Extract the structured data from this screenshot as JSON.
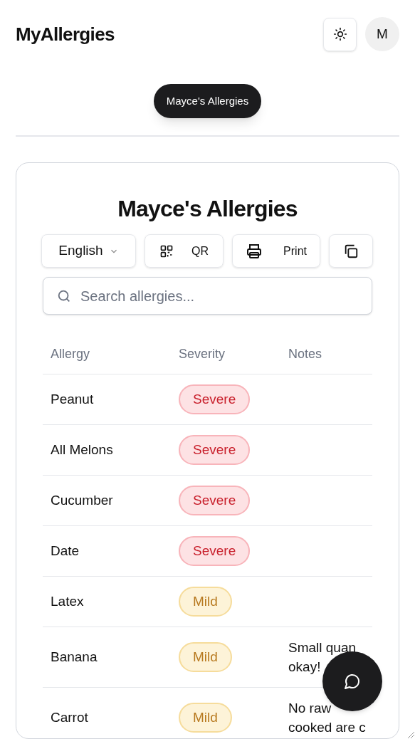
{
  "app_title": "MyAllergies",
  "avatar": "M",
  "profile_pill": "Mayce's Allergies",
  "card": {
    "title": "Mayce's Allergies",
    "language": "English",
    "qr_label": "QR",
    "print_label": "Print",
    "search": {
      "placeholder": "Search allergies..."
    },
    "table": {
      "columns": [
        "Allergy",
        "Severity",
        "Notes"
      ],
      "rows": [
        {
          "allergy": "Peanut",
          "severity": "Severe",
          "kind": "severe"
        },
        {
          "allergy": "All Melons",
          "severity": "Severe",
          "kind": "severe"
        },
        {
          "allergy": "Cucumber",
          "severity": "Severe",
          "kind": "severe"
        },
        {
          "allergy": "Date",
          "severity": "Severe",
          "kind": "severe"
        },
        {
          "allergy": "Latex",
          "severity": "Mild",
          "kind": "mild"
        },
        {
          "allergy": "Banana",
          "severity": "Mild",
          "kind": "mild",
          "notes": [
            "Small quan",
            "okay!"
          ]
        },
        {
          "allergy": "Carrot",
          "severity": "Mild",
          "kind": "mild",
          "notes": [
            "No raw",
            "cooked are c"
          ]
        }
      ]
    }
  }
}
